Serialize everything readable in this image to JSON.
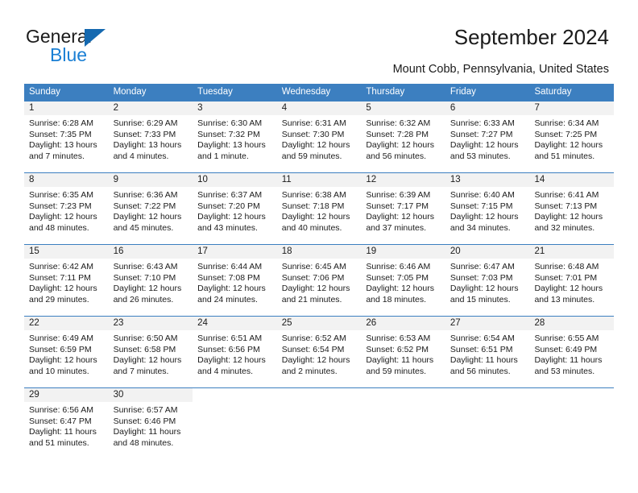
{
  "brand": {
    "name_part1": "General",
    "name_part2": "Blue",
    "triangle_icon": "triangle-icon",
    "accent_color": "#1a7fd4",
    "logo_dark_color": "#1b1b1b"
  },
  "header": {
    "title": "September 2024",
    "location": "Mount Cobb, Pennsylvania, United States"
  },
  "calendar": {
    "header_bg_color": "#3c7fc0",
    "day_band_color": "#f2f2f2",
    "weekdays": [
      "Sunday",
      "Monday",
      "Tuesday",
      "Wednesday",
      "Thursday",
      "Friday",
      "Saturday"
    ],
    "weeks": [
      [
        {
          "day": "1",
          "sunrise": "Sunrise: 6:28 AM",
          "sunset": "Sunset: 7:35 PM",
          "daylight_line1": "Daylight: 13 hours",
          "daylight_line2": "and 7 minutes."
        },
        {
          "day": "2",
          "sunrise": "Sunrise: 6:29 AM",
          "sunset": "Sunset: 7:33 PM",
          "daylight_line1": "Daylight: 13 hours",
          "daylight_line2": "and 4 minutes."
        },
        {
          "day": "3",
          "sunrise": "Sunrise: 6:30 AM",
          "sunset": "Sunset: 7:32 PM",
          "daylight_line1": "Daylight: 13 hours",
          "daylight_line2": "and 1 minute."
        },
        {
          "day": "4",
          "sunrise": "Sunrise: 6:31 AM",
          "sunset": "Sunset: 7:30 PM",
          "daylight_line1": "Daylight: 12 hours",
          "daylight_line2": "and 59 minutes."
        },
        {
          "day": "5",
          "sunrise": "Sunrise: 6:32 AM",
          "sunset": "Sunset: 7:28 PM",
          "daylight_line1": "Daylight: 12 hours",
          "daylight_line2": "and 56 minutes."
        },
        {
          "day": "6",
          "sunrise": "Sunrise: 6:33 AM",
          "sunset": "Sunset: 7:27 PM",
          "daylight_line1": "Daylight: 12 hours",
          "daylight_line2": "and 53 minutes."
        },
        {
          "day": "7",
          "sunrise": "Sunrise: 6:34 AM",
          "sunset": "Sunset: 7:25 PM",
          "daylight_line1": "Daylight: 12 hours",
          "daylight_line2": "and 51 minutes."
        }
      ],
      [
        {
          "day": "8",
          "sunrise": "Sunrise: 6:35 AM",
          "sunset": "Sunset: 7:23 PM",
          "daylight_line1": "Daylight: 12 hours",
          "daylight_line2": "and 48 minutes."
        },
        {
          "day": "9",
          "sunrise": "Sunrise: 6:36 AM",
          "sunset": "Sunset: 7:22 PM",
          "daylight_line1": "Daylight: 12 hours",
          "daylight_line2": "and 45 minutes."
        },
        {
          "day": "10",
          "sunrise": "Sunrise: 6:37 AM",
          "sunset": "Sunset: 7:20 PM",
          "daylight_line1": "Daylight: 12 hours",
          "daylight_line2": "and 43 minutes."
        },
        {
          "day": "11",
          "sunrise": "Sunrise: 6:38 AM",
          "sunset": "Sunset: 7:18 PM",
          "daylight_line1": "Daylight: 12 hours",
          "daylight_line2": "and 40 minutes."
        },
        {
          "day": "12",
          "sunrise": "Sunrise: 6:39 AM",
          "sunset": "Sunset: 7:17 PM",
          "daylight_line1": "Daylight: 12 hours",
          "daylight_line2": "and 37 minutes."
        },
        {
          "day": "13",
          "sunrise": "Sunrise: 6:40 AM",
          "sunset": "Sunset: 7:15 PM",
          "daylight_line1": "Daylight: 12 hours",
          "daylight_line2": "and 34 minutes."
        },
        {
          "day": "14",
          "sunrise": "Sunrise: 6:41 AM",
          "sunset": "Sunset: 7:13 PM",
          "daylight_line1": "Daylight: 12 hours",
          "daylight_line2": "and 32 minutes."
        }
      ],
      [
        {
          "day": "15",
          "sunrise": "Sunrise: 6:42 AM",
          "sunset": "Sunset: 7:11 PM",
          "daylight_line1": "Daylight: 12 hours",
          "daylight_line2": "and 29 minutes."
        },
        {
          "day": "16",
          "sunrise": "Sunrise: 6:43 AM",
          "sunset": "Sunset: 7:10 PM",
          "daylight_line1": "Daylight: 12 hours",
          "daylight_line2": "and 26 minutes."
        },
        {
          "day": "17",
          "sunrise": "Sunrise: 6:44 AM",
          "sunset": "Sunset: 7:08 PM",
          "daylight_line1": "Daylight: 12 hours",
          "daylight_line2": "and 24 minutes."
        },
        {
          "day": "18",
          "sunrise": "Sunrise: 6:45 AM",
          "sunset": "Sunset: 7:06 PM",
          "daylight_line1": "Daylight: 12 hours",
          "daylight_line2": "and 21 minutes."
        },
        {
          "day": "19",
          "sunrise": "Sunrise: 6:46 AM",
          "sunset": "Sunset: 7:05 PM",
          "daylight_line1": "Daylight: 12 hours",
          "daylight_line2": "and 18 minutes."
        },
        {
          "day": "20",
          "sunrise": "Sunrise: 6:47 AM",
          "sunset": "Sunset: 7:03 PM",
          "daylight_line1": "Daylight: 12 hours",
          "daylight_line2": "and 15 minutes."
        },
        {
          "day": "21",
          "sunrise": "Sunrise: 6:48 AM",
          "sunset": "Sunset: 7:01 PM",
          "daylight_line1": "Daylight: 12 hours",
          "daylight_line2": "and 13 minutes."
        }
      ],
      [
        {
          "day": "22",
          "sunrise": "Sunrise: 6:49 AM",
          "sunset": "Sunset: 6:59 PM",
          "daylight_line1": "Daylight: 12 hours",
          "daylight_line2": "and 10 minutes."
        },
        {
          "day": "23",
          "sunrise": "Sunrise: 6:50 AM",
          "sunset": "Sunset: 6:58 PM",
          "daylight_line1": "Daylight: 12 hours",
          "daylight_line2": "and 7 minutes."
        },
        {
          "day": "24",
          "sunrise": "Sunrise: 6:51 AM",
          "sunset": "Sunset: 6:56 PM",
          "daylight_line1": "Daylight: 12 hours",
          "daylight_line2": "and 4 minutes."
        },
        {
          "day": "25",
          "sunrise": "Sunrise: 6:52 AM",
          "sunset": "Sunset: 6:54 PM",
          "daylight_line1": "Daylight: 12 hours",
          "daylight_line2": "and 2 minutes."
        },
        {
          "day": "26",
          "sunrise": "Sunrise: 6:53 AM",
          "sunset": "Sunset: 6:52 PM",
          "daylight_line1": "Daylight: 11 hours",
          "daylight_line2": "and 59 minutes."
        },
        {
          "day": "27",
          "sunrise": "Sunrise: 6:54 AM",
          "sunset": "Sunset: 6:51 PM",
          "daylight_line1": "Daylight: 11 hours",
          "daylight_line2": "and 56 minutes."
        },
        {
          "day": "28",
          "sunrise": "Sunrise: 6:55 AM",
          "sunset": "Sunset: 6:49 PM",
          "daylight_line1": "Daylight: 11 hours",
          "daylight_line2": "and 53 minutes."
        }
      ],
      [
        {
          "day": "29",
          "sunrise": "Sunrise: 6:56 AM",
          "sunset": "Sunset: 6:47 PM",
          "daylight_line1": "Daylight: 11 hours",
          "daylight_line2": "and 51 minutes."
        },
        {
          "day": "30",
          "sunrise": "Sunrise: 6:57 AM",
          "sunset": "Sunset: 6:46 PM",
          "daylight_line1": "Daylight: 11 hours",
          "daylight_line2": "and 48 minutes."
        },
        {
          "day": "",
          "sunrise": "",
          "sunset": "",
          "daylight_line1": "",
          "daylight_line2": ""
        },
        {
          "day": "",
          "sunrise": "",
          "sunset": "",
          "daylight_line1": "",
          "daylight_line2": ""
        },
        {
          "day": "",
          "sunrise": "",
          "sunset": "",
          "daylight_line1": "",
          "daylight_line2": ""
        },
        {
          "day": "",
          "sunrise": "",
          "sunset": "",
          "daylight_line1": "",
          "daylight_line2": ""
        },
        {
          "day": "",
          "sunrise": "",
          "sunset": "",
          "daylight_line1": "",
          "daylight_line2": ""
        }
      ]
    ]
  }
}
